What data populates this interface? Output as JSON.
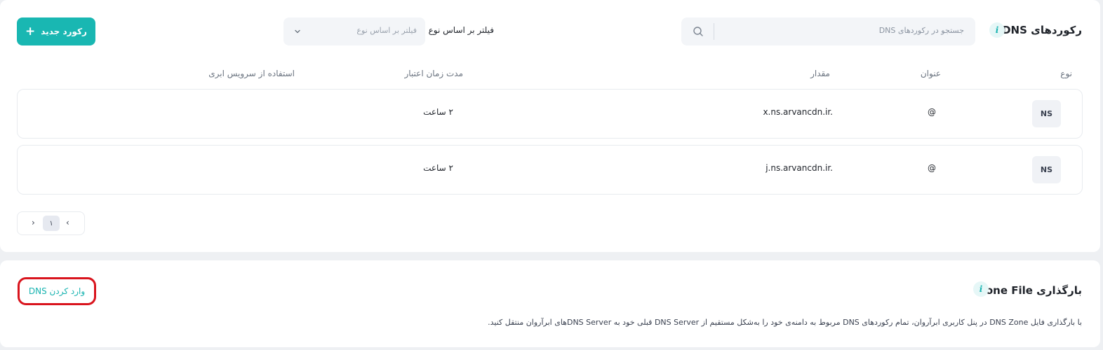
{
  "dns_records": {
    "title": "رکوردهای DNS",
    "info_icon": "i",
    "search": {
      "placeholder": "جستجو در رکوردهای DNS"
    },
    "filter": {
      "label": "فیلتر بر اساس نوع",
      "placeholder": "فیلتر بر اساس نوع"
    },
    "new_record_label": "رکورد جدید",
    "columns": {
      "type": "نوع",
      "name": "عنوان",
      "value": "مقدار",
      "ttl": "مدت زمان اعتبار",
      "cloud": "استفاده از سرویس ابری"
    },
    "rows": [
      {
        "type": "NS",
        "name": "@",
        "value": "x.ns.arvancdn.ir.",
        "ttl": "۲ ساعت"
      },
      {
        "type": "NS",
        "name": "@",
        "value": "j.ns.arvancdn.ir.",
        "ttl": "۲ ساعت"
      }
    ],
    "pagination": {
      "prev": "‹",
      "current": "۱",
      "next": "›"
    }
  },
  "zone_file": {
    "title": "بارگذاری Zone File",
    "info_icon": "i",
    "import_label": "وارد کردن DNS",
    "description": "با بارگذاری فایل DNS Zone در پنل کاربری ابرآروان، تمام رکوردهای DNS مربوط به دامنه‌ی خود را به‌شکل مستقیم از DNS Server قبلی خود به DNS Serverهای ابرآروان منتقل کنید."
  },
  "colors": {
    "accent": "#19b7b2",
    "highlight_border": "#d9141d",
    "card_bg": "#ffffff",
    "page_bg": "#eef0f3"
  }
}
